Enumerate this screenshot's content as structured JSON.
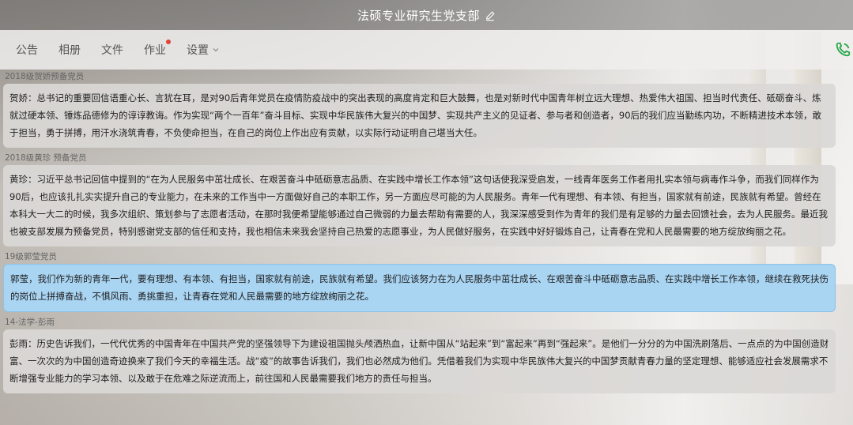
{
  "window": {
    "title": "法硕专业研究生党支部"
  },
  "tabs": [
    {
      "label": "公告"
    },
    {
      "label": "相册"
    },
    {
      "label": "文件"
    },
    {
      "label": "作业"
    },
    {
      "label": "设置"
    }
  ],
  "posts": [
    {
      "meta": "2018级贺娇预备党员",
      "text": "贺娇：总书记的重要回信语重心长、言犹在耳，是对90后青年党员在疫情防疫战中的突出表现的高度肯定和巨大鼓舞，也是对新时代中国青年树立远大理想、热爱伟大祖国、担当时代责任、砥砺奋斗、炼就过硬本领、锤炼品德修为的谆谆教诲。作为实现“两个一百年”奋斗目标、实现中华民族伟大复兴的中国梦、实现共产主义的见证者、参与者和创造者，90后的我们应当勤练内功，不断精进技术本领，敢于担当，勇于拼搏，用汗水浇筑青春，不负使命担当，在自己的岗位上作出应有贡献，以实际行动证明自己堪当大任。"
    },
    {
      "meta": "2018级黄珍 预备党员",
      "text": "黄珍：习近平总书记回信中提到的“在为人民服务中茁壮成长、在艰苦奋斗中砥砺意志品质、在实践中增长工作本领”这句话使我深受启发，一线青年医务工作者用扎实本领与病毒作斗争，而我们同样作为90后，也应该扎扎实实提升自己的专业能力，在未来的工作当中一方面做好自己的本职工作，另一方面应尽可能的为人民服务。青年一代有理想、有本领、有担当，国家就有前途，民族就有希望。曾经在本科大一大二的时候，我多次组织、策划参与了志愿者活动，在那时我便希望能够通过自己微弱的力量去帮助有需要的人，我深深感受到作为青年的我们是有足够的力量去回馈社会，去为人民服务。最近我也被支部发展为预备党员，特别感谢党支部的信任和支持，我也相信未来我会坚持自己热爱的志愿事业，为人民做好服务，在实践中好好锻炼自己，让青春在党和人民最需要的地方绽放绚丽之花。"
    },
    {
      "meta": "19级郭莹党员",
      "text": "郭莹，我们作为新的青年一代，要有理想、有本领、有担当，国家就有前途，民族就有希望。我们应该努力在为人民服务中茁壮成长、在艰苦奋斗中砥砺意志品质、在实践中增长工作本领，继续在救死扶伤的岗位上拼搏奋战，不惧风雨、勇挑重担，让青春在党和人民最需要的地方绽放绚丽之花。"
    },
    {
      "meta": "14-法学-彭雨",
      "text": "彭雨：历史告诉我们，一代代优秀的中国青年在中国共产党的坚强领导下为建设祖国抛头颅洒热血，让新中国从“站起来”到“富起来”再到“强起来”。是他们一分分的为中国洗刷落后、一点点的为中国创造财富、一次次的为中国创造奇迹换来了我们今天的幸福生活。战“疫”的故事告诉我们，我们也必然成为他们。凭借着我们为实现中华民族伟大复兴的中国梦贡献青春力量的坚定理想、能够适应社会发展需求不断增强专业能力的学习本领、以及敢于在危难之际逆流而上，前往国和人民最需要我们地方的责任与担当。"
    }
  ],
  "colors": {
    "selected_bubble": "#a9d4f2",
    "notification_dot": "#e0443b",
    "phone_icon": "#2aa84a"
  },
  "icons": {
    "edit": "edit-icon",
    "chevron": "chevron-down-icon",
    "phone": "phone-icon"
  }
}
